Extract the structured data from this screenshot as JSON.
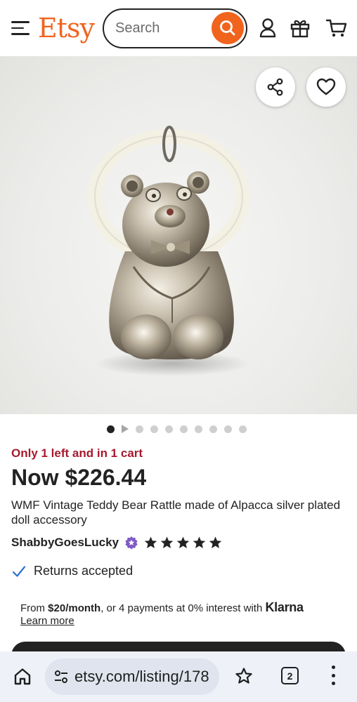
{
  "header": {
    "logo": "Etsy",
    "search": {
      "placeholder": "Search"
    },
    "icons": [
      "menu-icon",
      "search-icon",
      "account-icon",
      "gift-icon",
      "cart-icon"
    ]
  },
  "gallery": {
    "image_alt": "Silver teddy bear rattle with white ring",
    "dot_count": 10,
    "active_dot": 1,
    "actions": [
      "share-icon",
      "heart-icon"
    ]
  },
  "listing": {
    "stock_notice": "Only 1 left and in 1 cart",
    "price": "Now $226.44",
    "title": "WMF Vintage Teddy Bear Rattle made of Alpacca silver plated doll accessory",
    "seller": "ShabbyGoesLucky",
    "rating": 5,
    "returns": "Returns accepted",
    "klarna": {
      "prefix": "From ",
      "amount": "$20/month",
      "middle": ", or 4 payments at 0% interest with ",
      "brand": "Klarna",
      "learn_more": "Learn more"
    }
  },
  "browser": {
    "url": "etsy.com/listing/178",
    "tab_count": "2"
  },
  "colors": {
    "brand_orange": "#f1641e",
    "stock_red": "#a61a2e",
    "star_seller_purple": "#7f59c6",
    "check_blue": "#2f6fd0"
  }
}
